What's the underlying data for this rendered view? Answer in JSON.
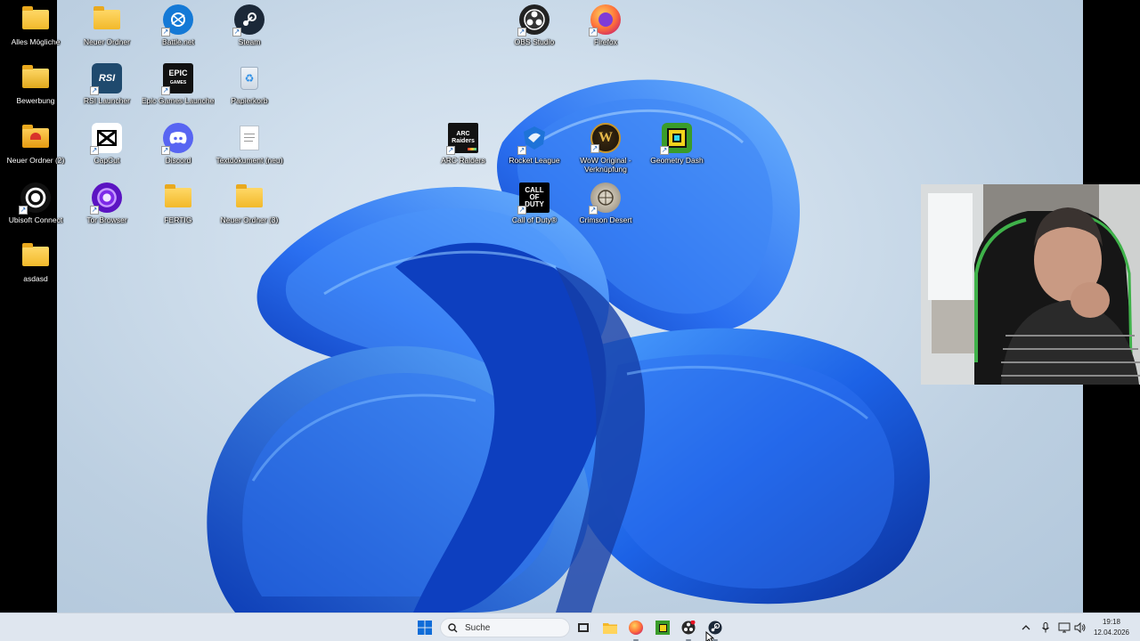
{
  "desktop_icons": [
    {
      "label": "Alles Mögliche",
      "icon": "folder-icon"
    },
    {
      "label": "Neuer Ordner",
      "icon": "folder-icon"
    },
    {
      "label": "Battle.net",
      "icon": "battlenet-icon"
    },
    {
      "label": "Steam",
      "icon": "steam-icon"
    },
    {
      "label": "OBS Studio",
      "icon": "obs-icon"
    },
    {
      "label": "Firefox",
      "icon": "firefox-icon"
    },
    {
      "label": "Bewerbung",
      "icon": "folder-icon"
    },
    {
      "label": "RSI Launcher",
      "icon": "rsi-icon"
    },
    {
      "label": "Epic Games Launcher",
      "icon": "epic-games-icon"
    },
    {
      "label": "Papierkorb",
      "icon": "recycle-bin-icon"
    },
    {
      "label": "Neuer Ordner (2)",
      "icon": "folder-icon"
    },
    {
      "label": "CapCut",
      "icon": "capcut-icon"
    },
    {
      "label": "Discord",
      "icon": "discord-icon"
    },
    {
      "label": "Textdokument (neu)",
      "icon": "text-document-icon"
    },
    {
      "label": "ARC Raiders",
      "icon": "arc-raiders-icon"
    },
    {
      "label": "Rocket League",
      "icon": "rocket-league-icon"
    },
    {
      "label": "WoW Original - Verknüpfung",
      "icon": "wow-icon"
    },
    {
      "label": "Geometry Dash",
      "icon": "geometry-dash-icon"
    },
    {
      "label": "Ubisoft Connect",
      "icon": "ubisoft-icon"
    },
    {
      "label": "Tor Browser",
      "icon": "tor-icon"
    },
    {
      "label": "FERTIG",
      "icon": "folder-icon"
    },
    {
      "label": "Neuer Ordner (3)",
      "icon": "folder-icon"
    },
    {
      "label": "Call of Duty®",
      "icon": "call-of-duty-icon"
    },
    {
      "label": "Crimson Desert",
      "icon": "crimson-desert-icon"
    },
    {
      "label": "asdasd",
      "icon": "folder-icon"
    }
  ],
  "taskbar": {
    "search_placeholder": "Suche",
    "apps": [
      "start-icon",
      "task-view-icon",
      "file-explorer-icon",
      "firefox-icon",
      "geometry-dash-icon",
      "obs-icon",
      "steam-icon"
    ],
    "time": "19:18",
    "date": "12.04.2026"
  },
  "colors": {
    "wallpaper_blue": "#1f5fe0",
    "taskbar_bg": "#dfe6ef"
  }
}
